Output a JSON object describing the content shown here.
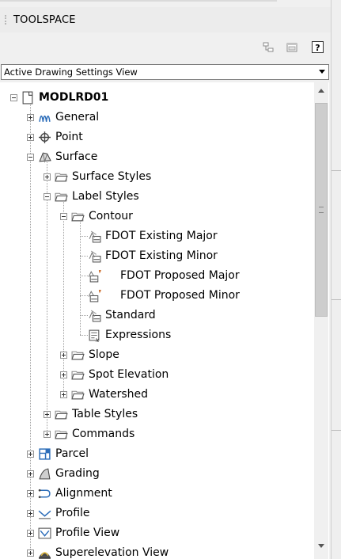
{
  "window": {
    "title": "TOOLSPACE"
  },
  "toolbar": {
    "help_label": "?"
  },
  "view_selector": {
    "selected": "Active Drawing Settings View"
  },
  "tree": [
    {
      "id": "root",
      "label": "MODLRD01",
      "depth": 0,
      "expander": "minus",
      "icon": "drawing-icon",
      "bold": true
    },
    {
      "id": "general",
      "label": "General",
      "depth": 1,
      "expander": "plus",
      "icon": "general-icon"
    },
    {
      "id": "point",
      "label": "Point",
      "depth": 1,
      "expander": "plus",
      "icon": "point-icon"
    },
    {
      "id": "surface",
      "label": "Surface",
      "depth": 1,
      "expander": "minus",
      "icon": "surface-icon"
    },
    {
      "id": "surface-styles",
      "label": "Surface Styles",
      "depth": 2,
      "expander": "plus",
      "icon": "folder-icon"
    },
    {
      "id": "label-styles",
      "label": "Label Styles",
      "depth": 2,
      "expander": "minus",
      "icon": "folder-icon"
    },
    {
      "id": "contour",
      "label": "Contour",
      "depth": 3,
      "expander": "minus",
      "icon": "folder-icon"
    },
    {
      "id": "fdot-existing-major",
      "label": "FDOT Existing Major",
      "depth": 4,
      "expander": "none",
      "icon": "label-style-icon"
    },
    {
      "id": "fdot-existing-minor",
      "label": "FDOT Existing Minor",
      "depth": 4,
      "expander": "none",
      "icon": "label-style-icon"
    },
    {
      "id": "fdot-proposed-major",
      "label": "FDOT Proposed Major",
      "depth": 4,
      "expander": "none",
      "icon": "label-style-flag-icon"
    },
    {
      "id": "fdot-proposed-minor",
      "label": "FDOT Proposed Minor",
      "depth": 4,
      "expander": "none",
      "icon": "label-style-flag-icon"
    },
    {
      "id": "standard",
      "label": "Standard",
      "depth": 4,
      "expander": "none",
      "icon": "label-style-icon"
    },
    {
      "id": "expressions",
      "label": "Expressions",
      "depth": 4,
      "expander": "none",
      "icon": "expressions-icon"
    },
    {
      "id": "slope",
      "label": "Slope",
      "depth": 3,
      "expander": "plus",
      "icon": "folder-icon"
    },
    {
      "id": "spot-elevation",
      "label": "Spot Elevation",
      "depth": 3,
      "expander": "plus",
      "icon": "folder-icon"
    },
    {
      "id": "watershed",
      "label": "Watershed",
      "depth": 3,
      "expander": "plus",
      "icon": "folder-icon"
    },
    {
      "id": "table-styles",
      "label": "Table Styles",
      "depth": 2,
      "expander": "plus",
      "icon": "folder-icon"
    },
    {
      "id": "commands",
      "label": "Commands",
      "depth": 2,
      "expander": "plus",
      "icon": "folder-icon"
    },
    {
      "id": "parcel",
      "label": "Parcel",
      "depth": 1,
      "expander": "plus",
      "icon": "parcel-icon"
    },
    {
      "id": "grading",
      "label": "Grading",
      "depth": 1,
      "expander": "plus",
      "icon": "grading-icon"
    },
    {
      "id": "alignment",
      "label": "Alignment",
      "depth": 1,
      "expander": "plus",
      "icon": "alignment-icon"
    },
    {
      "id": "profile",
      "label": "Profile",
      "depth": 1,
      "expander": "plus",
      "icon": "profile-icon"
    },
    {
      "id": "profile-view",
      "label": "Profile View",
      "depth": 1,
      "expander": "plus",
      "icon": "profile-view-icon"
    },
    {
      "id": "superelevation-view",
      "label": "Superelevation View",
      "depth": 1,
      "expander": "plus",
      "icon": "superelevation-icon"
    }
  ],
  "colors": {
    "folder": "#8a8a8a",
    "accent_blue": "#2f6fba",
    "flag_orange": "#c8641e",
    "tree_background": "#ffffff",
    "panel_background": "#f0f0f0"
  }
}
